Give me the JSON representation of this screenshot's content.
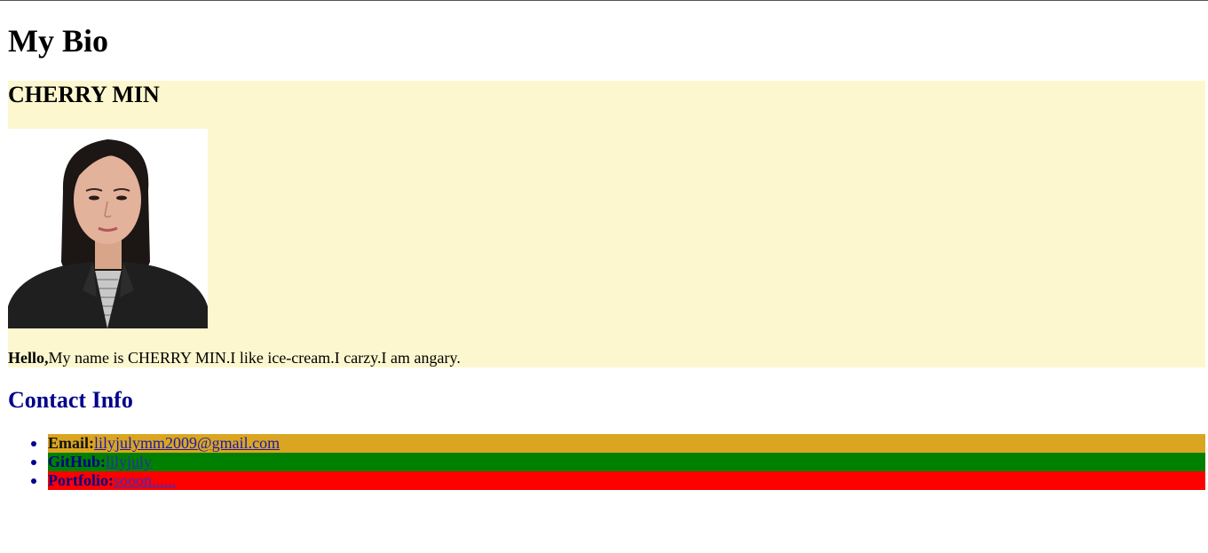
{
  "page": {
    "title": "My Bio"
  },
  "bio": {
    "name": "CHERRY MIN",
    "photo_icon": "portrait-photo",
    "greeting": "Hello,",
    "text": "My name is CHERRY MIN.I like ice-cream.I carzy.I am angary.",
    "background": "#fdf7cf"
  },
  "contact": {
    "title": "Contact Info",
    "items": [
      {
        "label": "Email:",
        "link": "lilyjulymm2009@gmail.com",
        "background": "#daa520"
      },
      {
        "label": "GitHub:",
        "link": "lilyjuly",
        "background": "#008000"
      },
      {
        "label": "Portfolio:",
        "link": "sooon......",
        "background": "#ff0000"
      }
    ]
  }
}
